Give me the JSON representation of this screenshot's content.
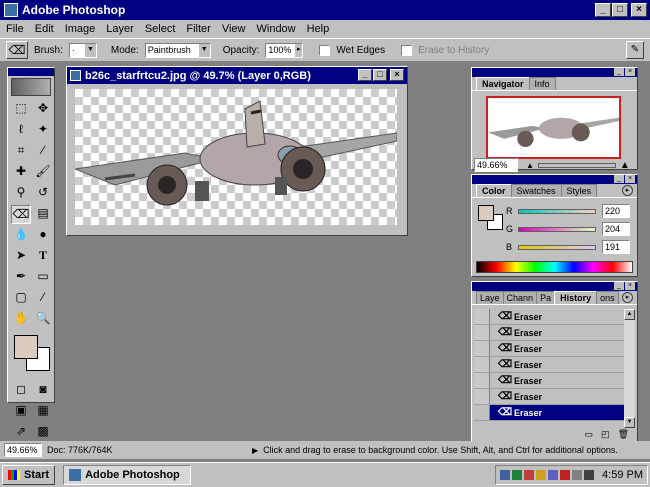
{
  "app": {
    "title": "Adobe Photoshop",
    "menu": [
      "File",
      "Edit",
      "Image",
      "Layer",
      "Select",
      "Filter",
      "View",
      "Window",
      "Help"
    ]
  },
  "options": {
    "brush_label": "Brush:",
    "mode_label": "Mode:",
    "mode_value": "Paintbrush",
    "opacity_label": "Opacity:",
    "opacity_value": "100%",
    "wet_edges_label": "Wet Edges",
    "erase_to_history_label": "Erase to History"
  },
  "document": {
    "title": "b26c_starfrtcu2.jpg @ 49.7% (Layer 0,RGB)"
  },
  "navigator": {
    "tabs": [
      "Navigator",
      "Info"
    ],
    "zoom": "49.66%"
  },
  "color": {
    "tabs": [
      "Color",
      "Swatches",
      "Styles"
    ],
    "channels": [
      {
        "label": "R",
        "value": "220"
      },
      {
        "label": "G",
        "value": "204"
      },
      {
        "label": "B",
        "value": "191"
      }
    ],
    "foreground": "#dccbbf",
    "background": "#ffffff"
  },
  "history": {
    "tabs": [
      "Laye",
      "Chann",
      "Pa",
      "History",
      "ons"
    ],
    "items": [
      "Eraser",
      "Eraser",
      "Eraser",
      "Eraser",
      "Eraser",
      "Eraser",
      "Eraser"
    ],
    "selected_index": 6
  },
  "status": {
    "zoom": "49.66%",
    "doc_size": "Doc: 776K/764K",
    "hint": "Click and drag to erase to background color. Use Shift, Alt, and Ctrl for additional options."
  },
  "taskbar": {
    "start_label": "Start",
    "task_label": "Adobe Photoshop",
    "clock": "4:59 PM"
  }
}
